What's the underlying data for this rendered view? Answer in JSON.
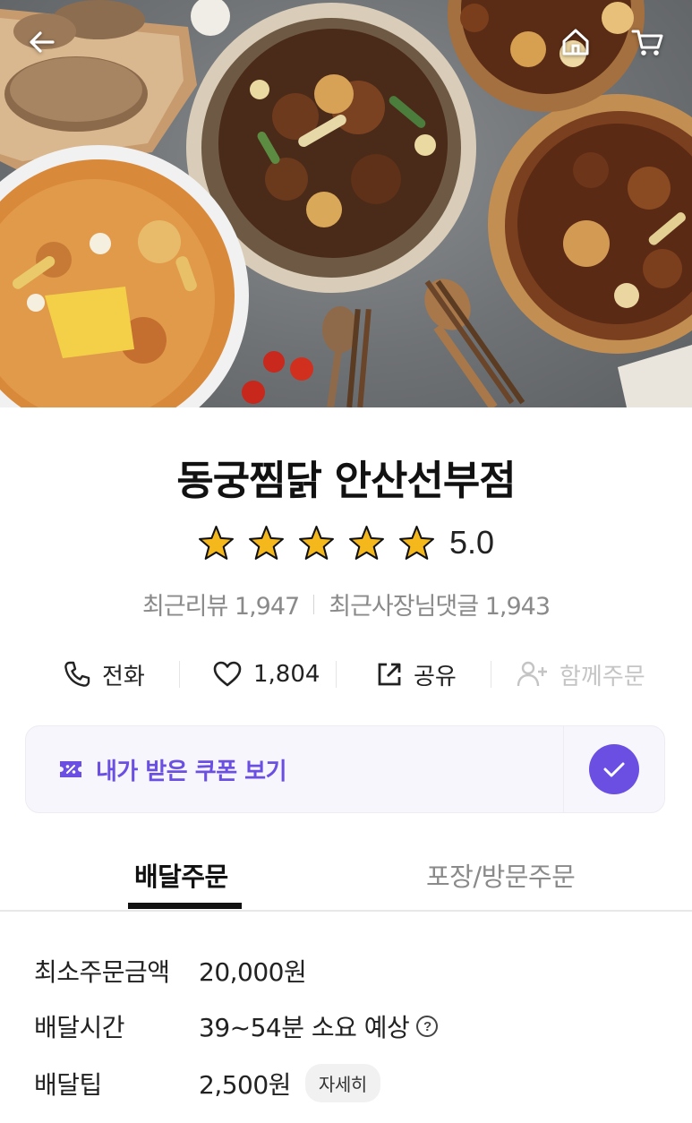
{
  "store": {
    "name": "동궁찜닭 안산선부점",
    "rating": "5.0",
    "stars_filled": 5,
    "recent_reviews": "최근리뷰 1,947",
    "recent_owner_replies": "최근사장님댓글 1,943"
  },
  "header_icons": [
    "back-arrow-icon",
    "home-icon",
    "cart-icon"
  ],
  "actions": {
    "call_label": "전화",
    "like_count": "1,804",
    "share_label": "공유",
    "group_order_label": "함께주문"
  },
  "coupon": {
    "label": "내가 받은 쿠폰 보기"
  },
  "tabs": [
    {
      "label": "배달주문",
      "active": true
    },
    {
      "label": "포장/방문주문",
      "active": false
    }
  ],
  "info": {
    "min_order_label": "최소주문금액",
    "min_order_value": "20,000원",
    "delivery_time_label": "배달시간",
    "delivery_time_value": "39~54분 소요 예상",
    "delivery_tip_label": "배달팁",
    "delivery_tip_value": "2,500원",
    "detail_label": "자세히"
  },
  "colors": {
    "accent": "#6b4fe2",
    "star": "#f5b81c",
    "muted_text": "#8a8a8a"
  }
}
